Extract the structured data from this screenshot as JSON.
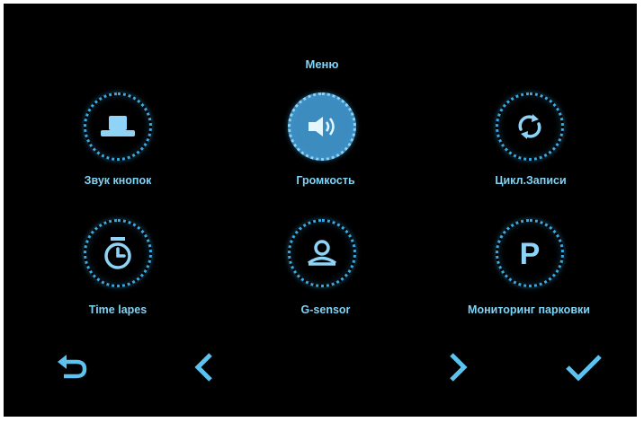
{
  "menu": {
    "title": "Меню"
  },
  "items": [
    {
      "label": "Звук кнопок",
      "icon": "button-icon",
      "selected": false
    },
    {
      "label": "Громкость",
      "icon": "speaker-volume-icon",
      "selected": true
    },
    {
      "label": "Цикл.Записи",
      "icon": "loop-icon",
      "selected": false
    },
    {
      "label": "Time lapes",
      "icon": "timer-icon",
      "selected": false
    },
    {
      "label": "G-sensor",
      "icon": "person-icon",
      "selected": false
    },
    {
      "label": "Мониторинг парковки",
      "icon": "parking-icon",
      "selected": false
    }
  ],
  "nav": {
    "back": "back-arrow-icon",
    "prev": "chevron-left-icon",
    "next": "chevron-right-icon",
    "confirm": "checkmark-icon"
  },
  "colors": {
    "accent": "#3aa9e0",
    "text": "#7fd3f5",
    "selected_fill": "#3d8cc0",
    "background": "#000000"
  }
}
